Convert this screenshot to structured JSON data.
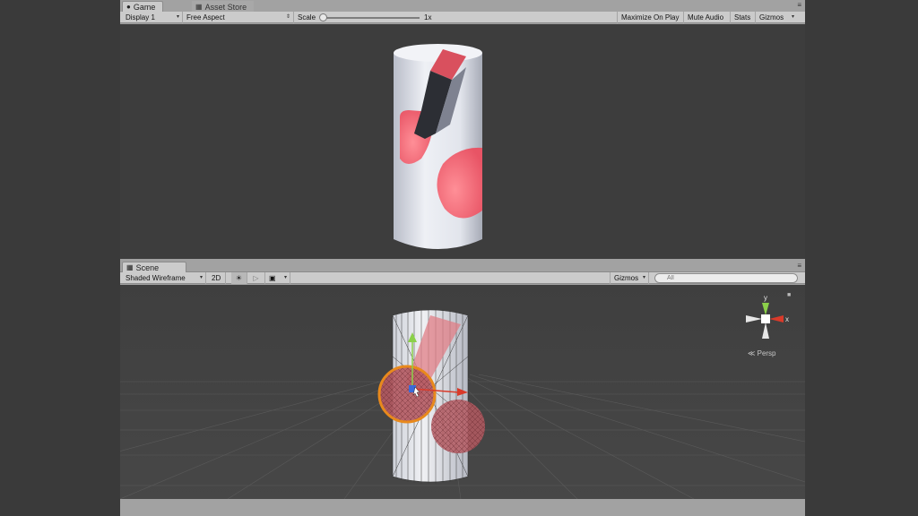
{
  "game": {
    "tabs": [
      {
        "label": "Game",
        "icon": "game-controller-icon"
      },
      {
        "label": "Asset Store",
        "icon": "asset-store-icon"
      }
    ],
    "toolbar": {
      "display": "Display 1",
      "aspect": "Free Aspect",
      "scale_label": "Scale",
      "scale_value": "1x",
      "maximize_on_play": "Maximize On Play",
      "mute_audio": "Mute Audio",
      "stats": "Stats",
      "gizmos": "Gizmos"
    }
  },
  "scene": {
    "tab": {
      "label": "Scene",
      "icon": "scene-grid-icon"
    },
    "toolbar": {
      "draw_mode": "Shaded Wireframe",
      "mode_2d": "2D",
      "gizmos": "Gizmos",
      "search_placeholder": "All"
    },
    "orientation": {
      "y_label": "y",
      "x_label": "x",
      "projection": "Persp"
    }
  },
  "colors": {
    "viewport_bg": "#3d3d3d",
    "cylinder": "#dfe2ea",
    "hole_pink": "#f06b7a",
    "selection_orange": "#e8891c",
    "axis_x": "#d93a2a",
    "axis_y": "#8bd04a",
    "axis_z": "#3a6ad9"
  }
}
